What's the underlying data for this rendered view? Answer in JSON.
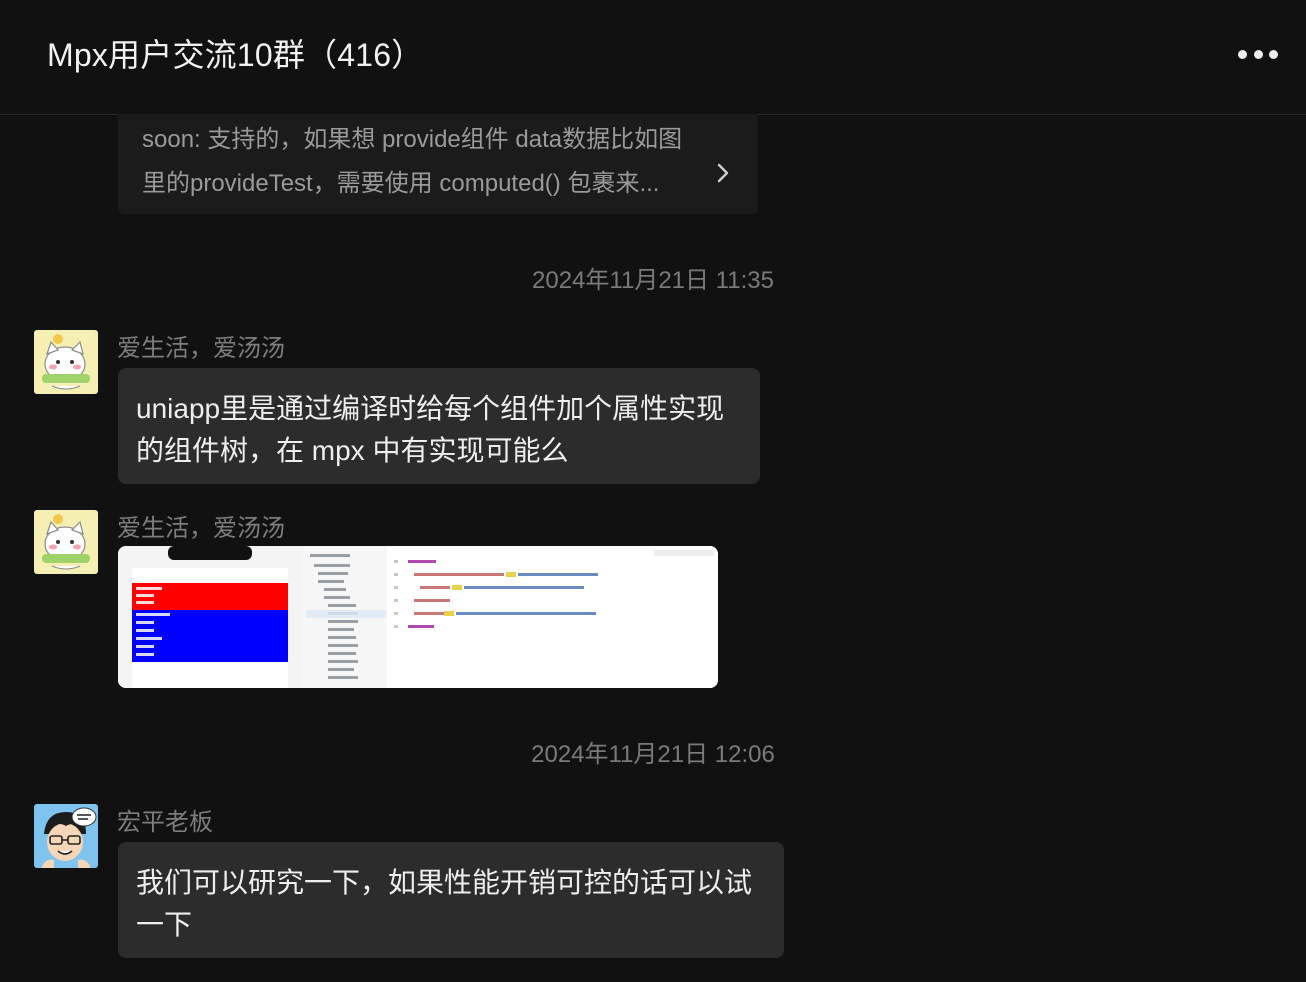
{
  "header": {
    "title": "Mpx用户交流10群（416）",
    "more_icon": "more-horizontal-icon"
  },
  "quoted_message": {
    "text": "soon: 支持的，如果想 provide组件 data数据比如图里的provideTest，需要使用 computed() 包裹来...",
    "chevron_icon": "chevron-right-icon"
  },
  "messages": [
    {
      "type": "timestamp",
      "text": "2024年11月21日 11:35"
    },
    {
      "type": "text",
      "sender": "爱生活，爱汤汤",
      "avatar": "cat-avatar",
      "text": "uniapp里是通过编译时给每个组件加个属性实现的组件树，在 mpx 中有实现可能么"
    },
    {
      "type": "image",
      "sender": "爱生活，爱汤汤",
      "avatar": "cat-avatar",
      "image": "code-screenshot-thumbnail"
    },
    {
      "type": "timestamp",
      "text": "2024年11月21日 12:06"
    },
    {
      "type": "text",
      "sender": "宏平老板",
      "avatar": "cartoon-boy-avatar",
      "text": "我们可以研究一下，如果性能开销可控的话可以试一下"
    }
  ],
  "colors": {
    "background": "#111111",
    "bubble": "#2c2c2c",
    "quote_bg": "#1b1b1b",
    "meta_text": "#7a7a7a"
  }
}
